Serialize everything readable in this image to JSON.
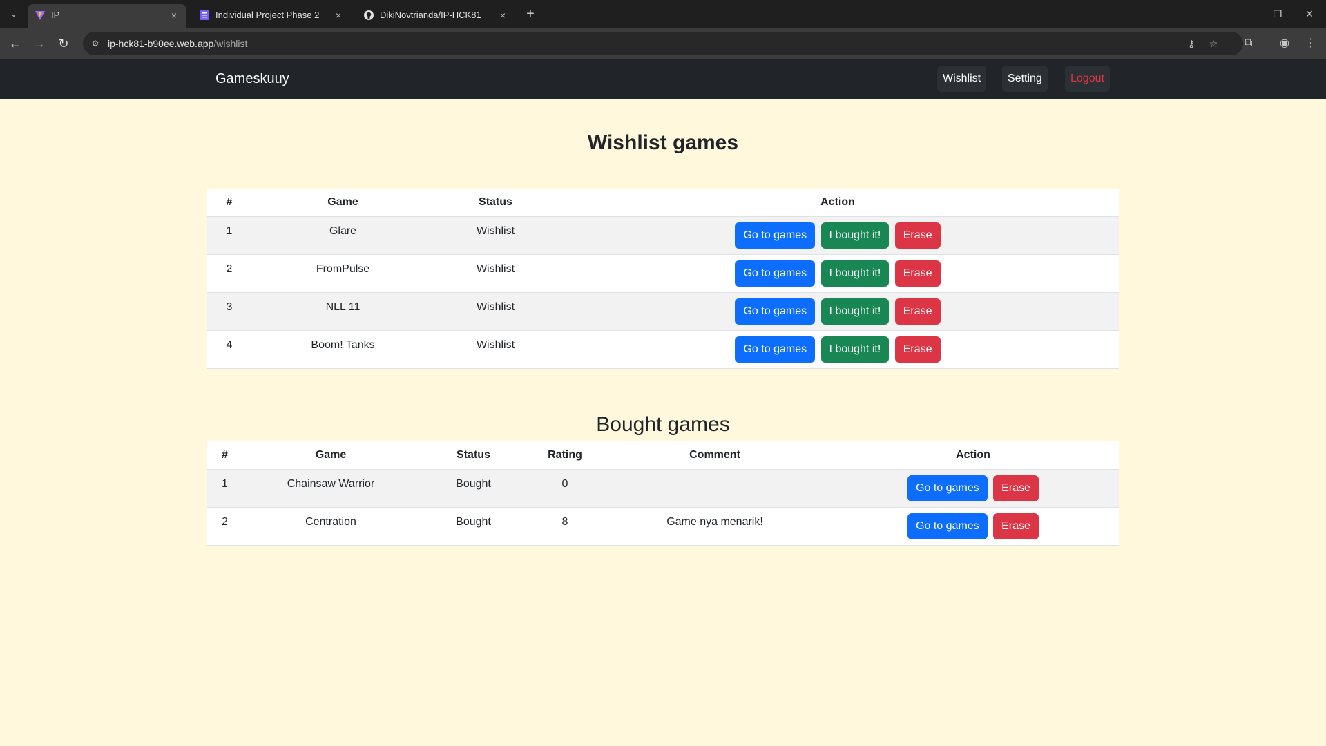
{
  "browser": {
    "tabs": [
      {
        "title": "IP",
        "active": true
      },
      {
        "title": "Individual Project Phase 2",
        "active": false
      },
      {
        "title": "DikiNovtrianda/IP-HCK81",
        "active": false
      }
    ],
    "url_host": "ip-hck81-b90ee.web.app",
    "url_path": "/wishlist"
  },
  "navbar": {
    "brand": "Gameskuuy",
    "links": [
      "Wishlist",
      "Setting",
      "Logout"
    ]
  },
  "wishlist": {
    "title": "Wishlist games",
    "headers": [
      "#",
      "Game",
      "Status",
      "Action"
    ],
    "rows": [
      {
        "no": "1",
        "game": "Glare",
        "status": "Wishlist"
      },
      {
        "no": "2",
        "game": "FromPulse",
        "status": "Wishlist"
      },
      {
        "no": "3",
        "game": "NLL 11",
        "status": "Wishlist"
      },
      {
        "no": "4",
        "game": "Boom! Tanks",
        "status": "Wishlist"
      }
    ],
    "buttons": {
      "go": "Go to games",
      "bought": "I bought it!",
      "erase": "Erase"
    }
  },
  "bought": {
    "title": "Bought games",
    "headers": [
      "#",
      "Game",
      "Status",
      "Rating",
      "Comment",
      "Action"
    ],
    "rows": [
      {
        "no": "1",
        "game": "Chainsaw Warrior",
        "status": "Bought",
        "rating": "0",
        "comment": ""
      },
      {
        "no": "2",
        "game": "Centration",
        "status": "Bought",
        "rating": "8",
        "comment": "Game nya menarik!"
      }
    ],
    "buttons": {
      "go": "Go to games",
      "erase": "Erase"
    }
  },
  "colors": {
    "page_bg": "#fff8dc",
    "navbar_bg": "#212529",
    "primary": "#0d6efd",
    "success": "#198754",
    "danger": "#dc3545"
  }
}
